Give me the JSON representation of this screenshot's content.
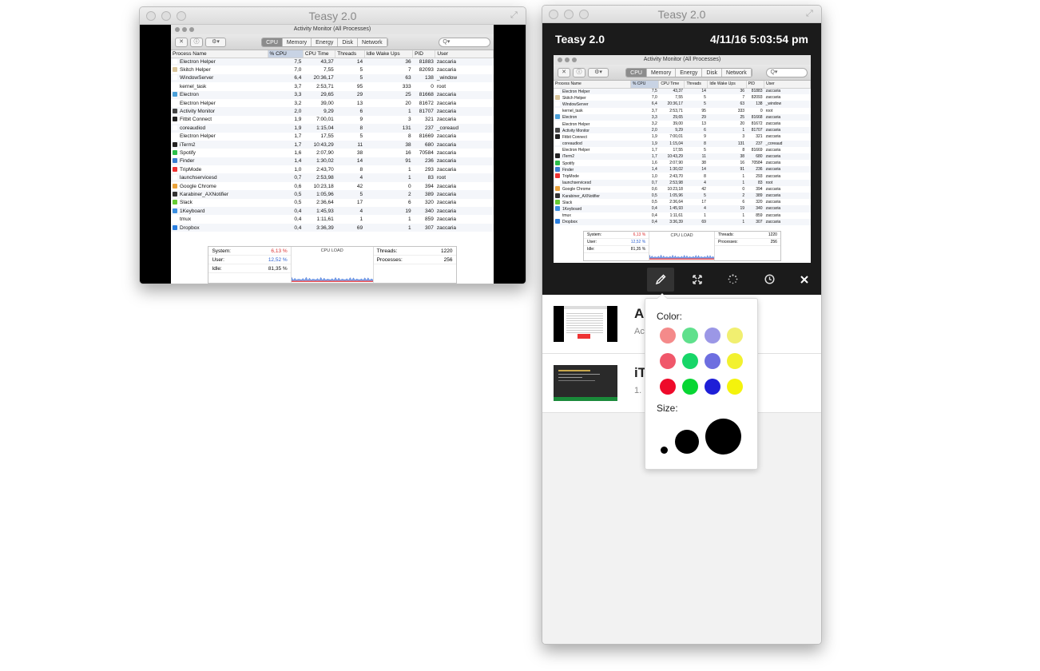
{
  "left_window": {
    "title": "Teasy 2.0"
  },
  "right_window": {
    "title": "Teasy 2.0",
    "header_title": "Teasy 2.0",
    "header_datetime": "4/11/16 5:03:54 pm"
  },
  "activity_monitor": {
    "title": "Activity Monitor (All Processes)",
    "tabs": [
      "CPU",
      "Memory",
      "Energy",
      "Disk",
      "Network"
    ],
    "selected_tab": "CPU",
    "search_placeholder": "Q▾",
    "columns": [
      "Process Name",
      "% CPU",
      "CPU Time",
      "Threads",
      "Idle Wake Ups",
      "PID",
      "User"
    ],
    "rows": [
      [
        "Electron Helper",
        "7,5",
        "43,37",
        "14",
        "36",
        "81883",
        "zaccaria"
      ],
      [
        "Skitch Helper",
        "7,0",
        "7,55",
        "5",
        "7",
        "82093",
        "zaccaria"
      ],
      [
        "WindowServer",
        "6,4",
        "20:36,17",
        "5",
        "63",
        "138",
        "_window"
      ],
      [
        "kernel_task",
        "3,7",
        "2:53,71",
        "95",
        "333",
        "0",
        "root"
      ],
      [
        "Electron",
        "3,3",
        "29,65",
        "29",
        "25",
        "81668",
        "zaccaria"
      ],
      [
        "Electron Helper",
        "3,2",
        "39,00",
        "13",
        "20",
        "81672",
        "zaccaria"
      ],
      [
        "Activity Monitor",
        "2,0",
        "9,29",
        "6",
        "1",
        "81707",
        "zaccaria"
      ],
      [
        "Fitbit Connect",
        "1,9",
        "7:00,01",
        "9",
        "3",
        "321",
        "zaccaria"
      ],
      [
        "coreaudiod",
        "1,9",
        "1:15,04",
        "8",
        "131",
        "237",
        "_coreaud"
      ],
      [
        "Electron Helper",
        "1,7",
        "17,55",
        "5",
        "8",
        "81669",
        "zaccaria"
      ],
      [
        "iTerm2",
        "1,7",
        "10:43,29",
        "11",
        "38",
        "680",
        "zaccaria"
      ],
      [
        "Spotify",
        "1,6",
        "2:07,90",
        "38",
        "16",
        "70584",
        "zaccaria"
      ],
      [
        "Finder",
        "1,4",
        "1:30,02",
        "14",
        "91",
        "236",
        "zaccaria"
      ],
      [
        "TripMode",
        "1,0",
        "2:43,70",
        "8",
        "1",
        "293",
        "zaccaria"
      ],
      [
        "launchservicesd",
        "0,7",
        "2:53,98",
        "4",
        "1",
        "83",
        "root"
      ],
      [
        "Google Chrome",
        "0,6",
        "10:23,18",
        "42",
        "0",
        "394",
        "zaccaria"
      ],
      [
        "Karabiner_AXNotifier",
        "0,5",
        "1:05,96",
        "5",
        "2",
        "389",
        "zaccaria"
      ],
      [
        "Slack",
        "0,5",
        "2:36,64",
        "17",
        "6",
        "320",
        "zaccaria"
      ],
      [
        "1Keyboard",
        "0,4",
        "1:45,93",
        "4",
        "19",
        "340",
        "zaccaria"
      ],
      [
        "tmux",
        "0,4",
        "1:11,61",
        "1",
        "1",
        "859",
        "zaccaria"
      ],
      [
        "Dropbox",
        "0,4",
        "3:36,39",
        "69",
        "1",
        "307",
        "zaccaria"
      ]
    ],
    "stats": {
      "system_label": "System:",
      "system_value": "6,13 %",
      "user_label": "User:",
      "user_value": "12,52 %",
      "idle_label": "Idle:",
      "idle_value": "81,35 %",
      "cpu_load_label": "CPU LOAD",
      "threads_label": "Threads:",
      "threads_value": "1220",
      "processes_label": "Processes:",
      "processes_value": "256"
    }
  },
  "toolbar": {
    "tools": [
      "pen-icon",
      "expand-icon",
      "spinner-icon",
      "clock-icon",
      "close-icon"
    ]
  },
  "list": [
    {
      "title": "A",
      "subtitle": "Ac"
    },
    {
      "title": "iT",
      "subtitle": "1. "
    }
  ],
  "popover": {
    "color_label": "Color:",
    "size_label": "Size:",
    "colors": [
      "#f48a8a",
      "#5fe08c",
      "#9b97e6",
      "#f1ef70",
      "#f0576a",
      "#17d668",
      "#6d6ee0",
      "#f2f12f",
      "#ee0a2a",
      "#07d633",
      "#1e1fd7",
      "#f4f30c"
    ]
  }
}
